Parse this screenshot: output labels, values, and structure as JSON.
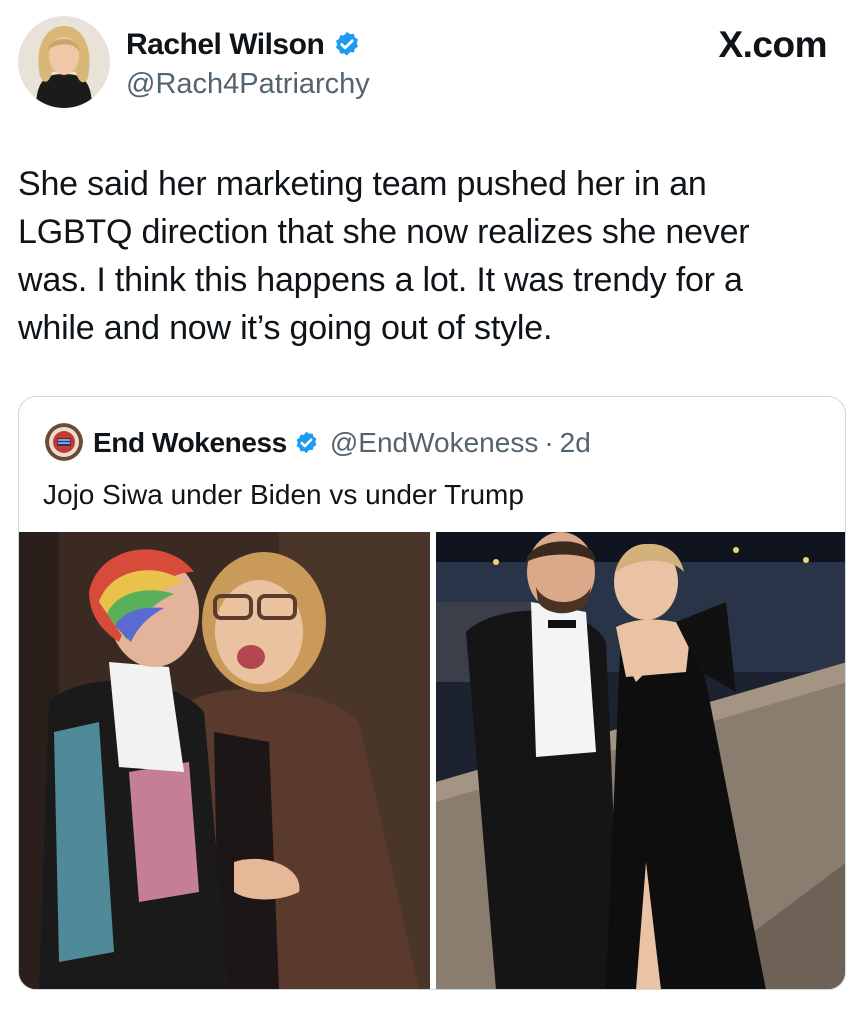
{
  "author": {
    "name": "Rachel Wilson",
    "handle": "@Rach4Patriarchy",
    "verified_icon": "verified-badge-icon",
    "verified_color": "#1d9bf0"
  },
  "brand": "X.com",
  "tweet": {
    "text": "She said her marketing team pushed her in an\nLGBTQ direction that she now realizes she never\nwas. I think this happens a lot. It was trendy for a\nwhile and now it’s going out of style."
  },
  "quote": {
    "name": "End Wokeness",
    "handle": "@EndWokeness",
    "separator": "·",
    "time": "2d",
    "text": "Jojo Siwa under Biden vs under Trump",
    "media": [
      "photo-left",
      "photo-right"
    ]
  },
  "colors": {
    "text": "#0f1419",
    "secondary": "#536471",
    "border": "#cfd9de",
    "verified": "#1d9bf0"
  }
}
